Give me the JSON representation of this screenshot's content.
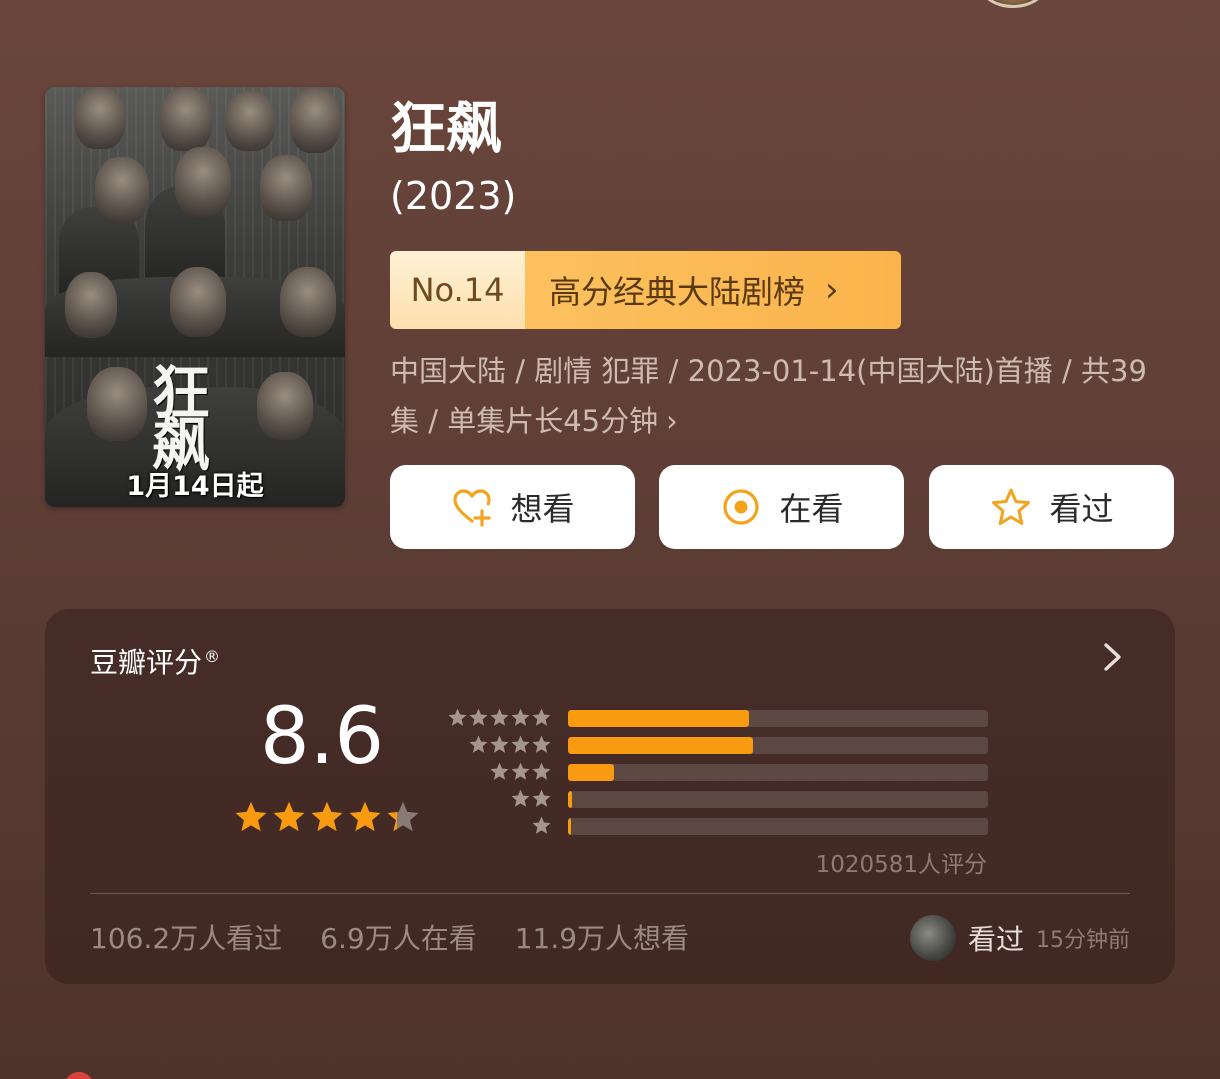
{
  "title": "狂飙",
  "year": "(2023)",
  "poster": {
    "title_text": "狂飙",
    "date_text": "1月14日起"
  },
  "ranking": {
    "number": "No.14",
    "list_name": "高分经典大陆剧榜",
    "chevron": "›"
  },
  "meta": {
    "text": "中国大陆 / 剧情 犯罪 / 2023-01-14(中国大陆)首播 / 共39集 / 单集片长45分钟",
    "chevron": "›"
  },
  "actions": {
    "want": "想看",
    "doing": "在看",
    "done": "看过"
  },
  "rating": {
    "label": "豆瓣评分",
    "registered_mark": "®",
    "score": "8.6",
    "star_value": 4.3,
    "distribution": [
      {
        "stars": 5,
        "fraction": 0.43
      },
      {
        "stars": 4,
        "fraction": 0.44
      },
      {
        "stars": 3,
        "fraction": 0.11
      },
      {
        "stars": 2,
        "fraction": 0.01
      },
      {
        "stars": 1,
        "fraction": 0.005
      }
    ],
    "count_text": "1020581人评分"
  },
  "stats": {
    "watched": "106.2万人看过",
    "watching": "6.9万人在看",
    "wish": "11.9万人想看"
  },
  "recent": {
    "action": "看过",
    "time": "15分钟前"
  },
  "colors": {
    "accent": "#f89b11",
    "background": "#5b3c34",
    "rank_gold": "#fbb44c"
  },
  "icons": {
    "want": "heart-plus-icon",
    "doing": "target-icon",
    "done": "star-outline-icon",
    "card_arrow": "chevron-right-icon"
  }
}
